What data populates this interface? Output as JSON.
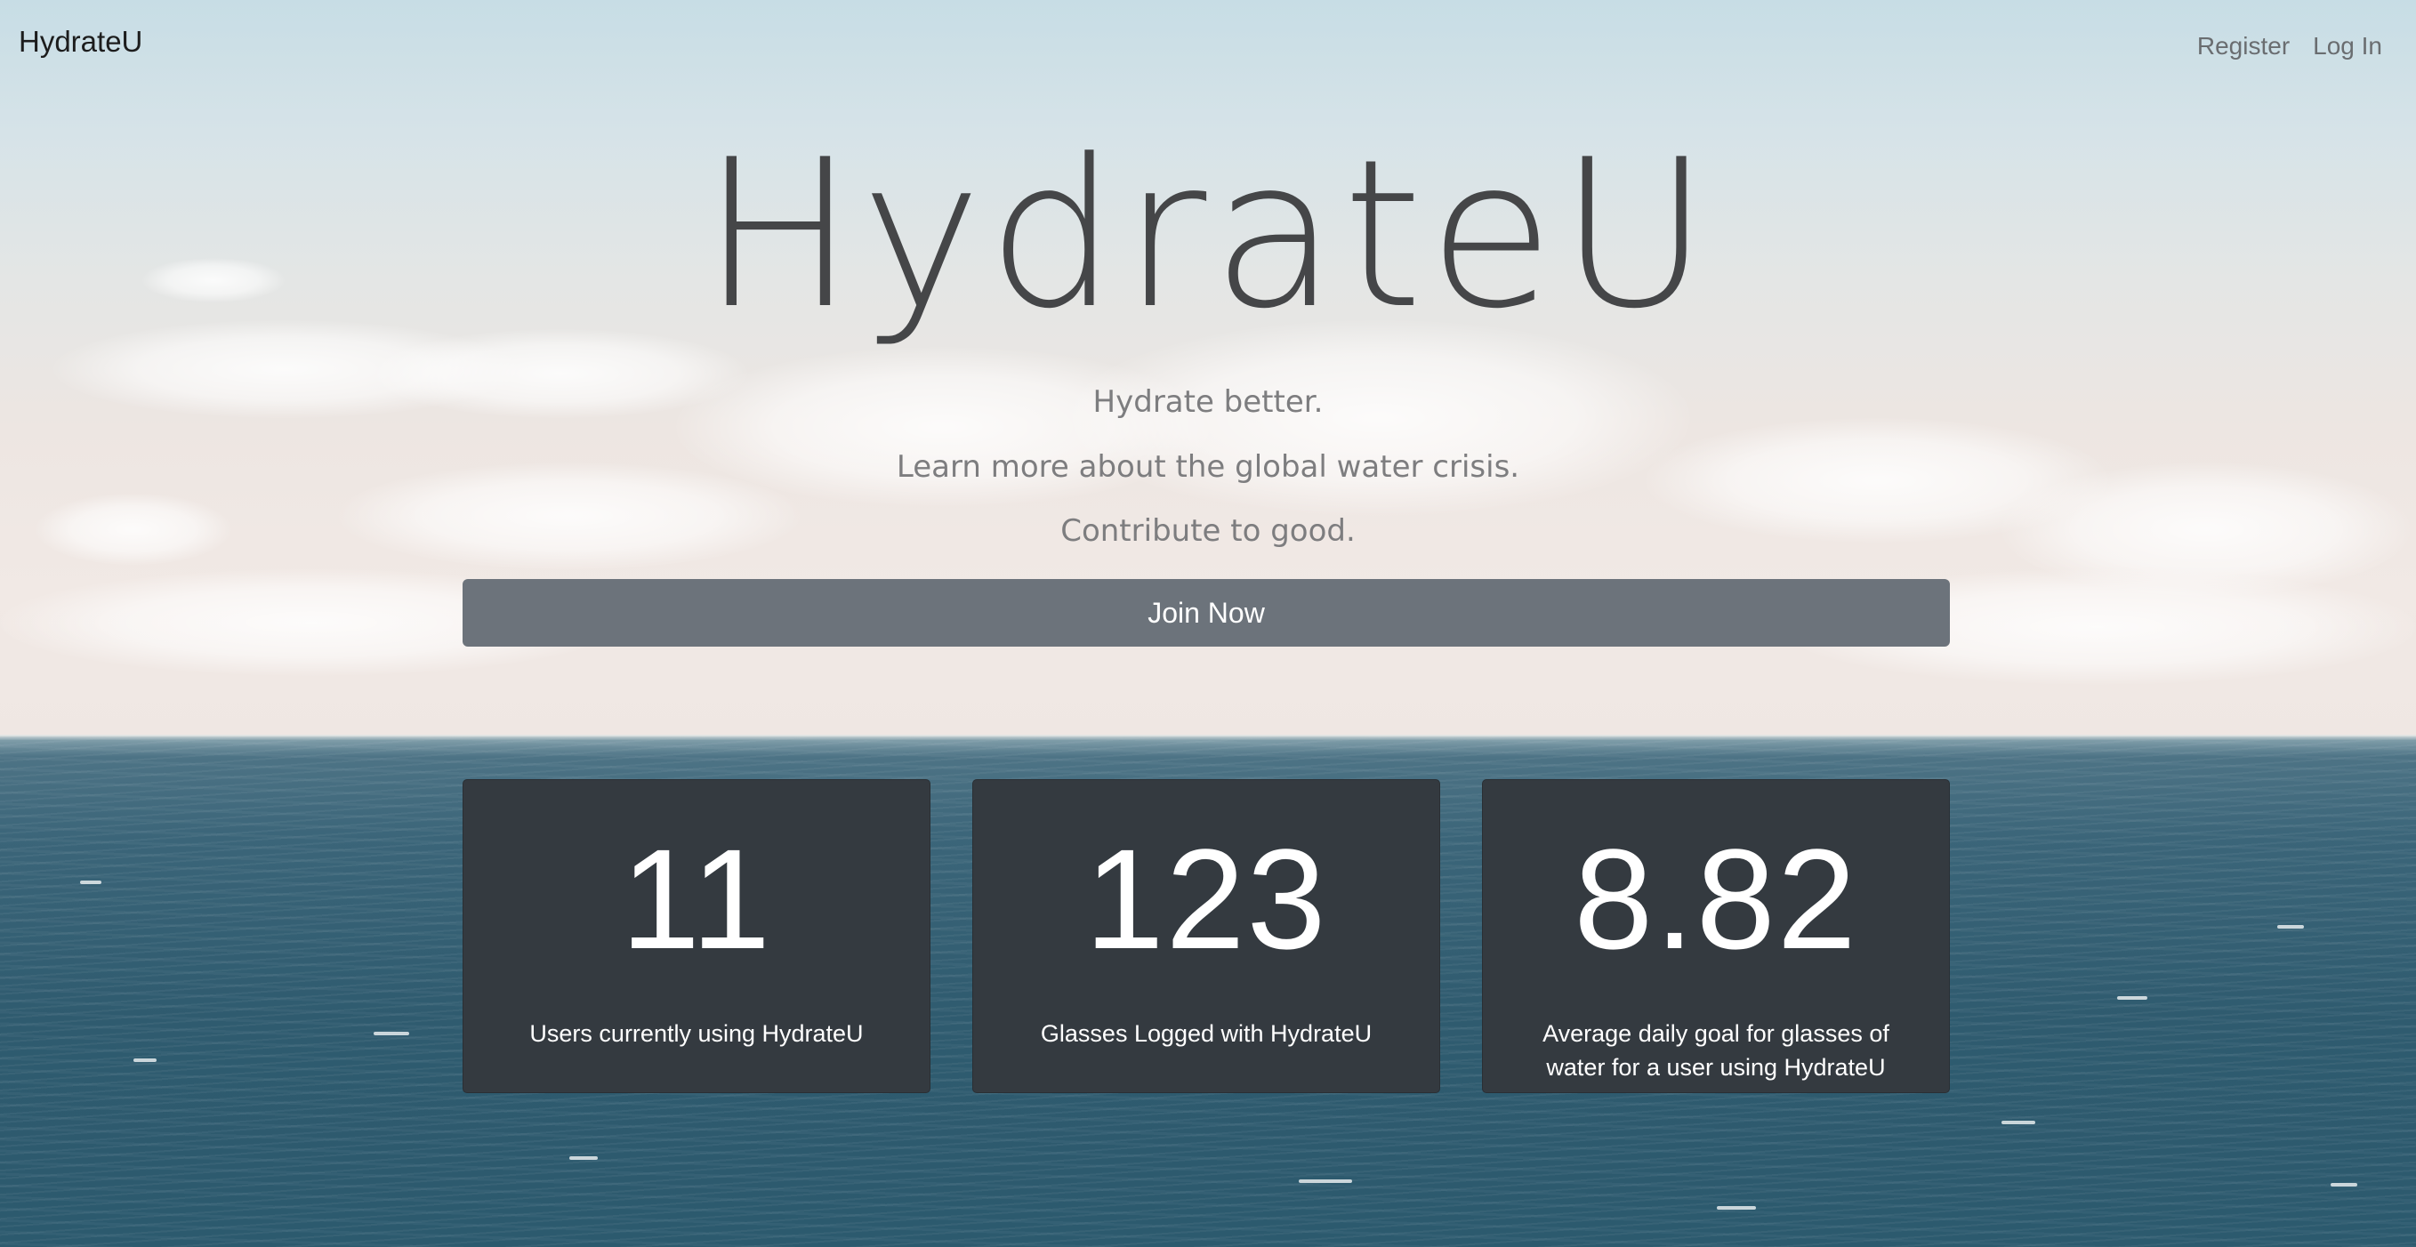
{
  "navbar": {
    "brand": "HydrateU",
    "links": [
      {
        "label": "Register"
      },
      {
        "label": "Log In"
      }
    ]
  },
  "hero": {
    "title": "HydrateU",
    "taglines": [
      "Hydrate better.",
      "Learn more about the global water crisis.",
      "Contribute to good."
    ],
    "cta_label": "Join Now"
  },
  "stats": [
    {
      "value": "11",
      "label": "Users currently using HydrateU"
    },
    {
      "value": "123",
      "label": "Glasses Logged with HydrateU"
    },
    {
      "value": "8.82",
      "label": "Average daily goal for glasses of water for a user using HydrateU"
    }
  ],
  "colors": {
    "button": "#6c737b",
    "card": "#343a40",
    "title": "#454648"
  }
}
